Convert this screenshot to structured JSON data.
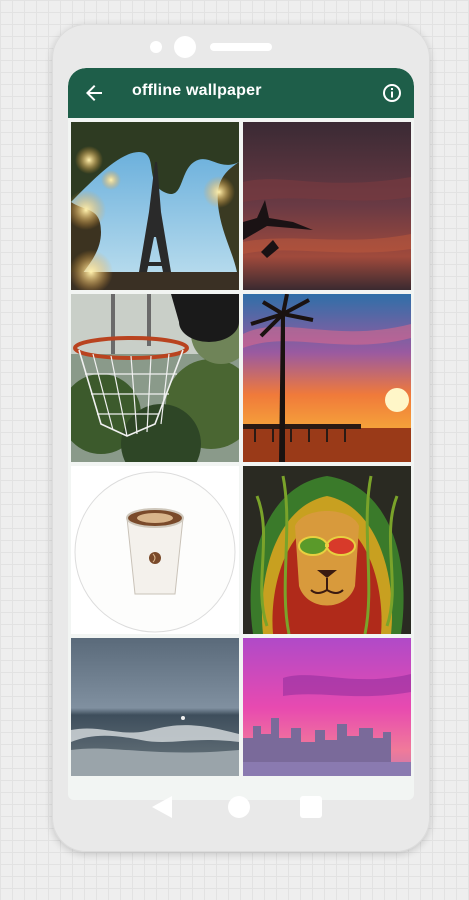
{
  "appbar": {
    "title": "offline wallpaper",
    "back_icon": "arrow-left-icon",
    "info_icon": "info-circle-icon",
    "color": "#1e5e49"
  },
  "wallpapers": [
    {
      "subject": "eiffel-tower"
    },
    {
      "subject": "dusk-sky-branches"
    },
    {
      "subject": "basketball-hoop"
    },
    {
      "subject": "palm-sunset-pier"
    },
    {
      "subject": "coffee-cup"
    },
    {
      "subject": "rasta-lion"
    },
    {
      "subject": "sea-waves"
    },
    {
      "subject": "pink-city-skyline"
    }
  ],
  "navbar": {
    "back_icon": "triangle-back-icon",
    "home_icon": "circle-home-icon",
    "recents_icon": "square-recents-icon"
  }
}
